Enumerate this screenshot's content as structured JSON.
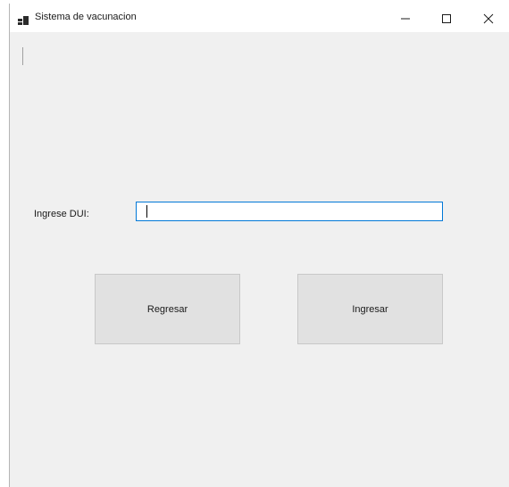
{
  "window": {
    "title": "Sistema de vacunacion",
    "icon": "app-window-icon",
    "controls": {
      "minimize_icon": "minimize-icon",
      "maximize_icon": "maximize-icon",
      "close_icon": "close-icon"
    }
  },
  "form": {
    "dui_label": "Ingrese DUI:",
    "dui_value": "",
    "regresar_label": "Regresar",
    "ingresar_label": "Ingresar"
  },
  "colors": {
    "window_bg": "#f0f0f0",
    "titlebar_bg": "#ffffff",
    "input_focus_border": "#0078d7",
    "button_bg": "#e1e1e1"
  }
}
